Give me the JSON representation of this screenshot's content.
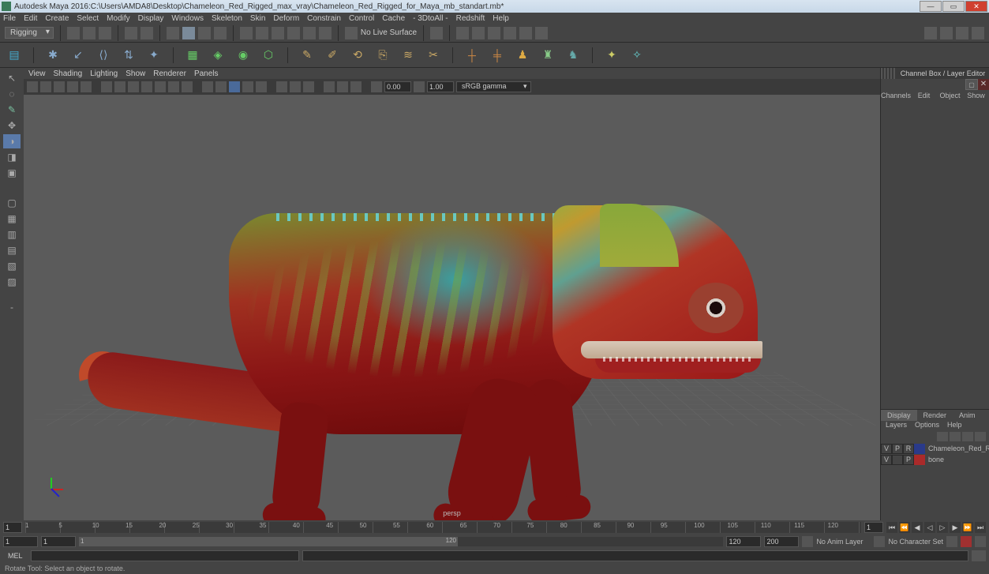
{
  "titlebar": {
    "app": "Autodesk Maya 2016: ",
    "path": "C:\\Users\\AMDA8\\Desktop\\Chameleon_Red_Rigged_max_vray\\Chameleon_Red_Rigged_for_Maya_mb_standart.mb*"
  },
  "menubar": [
    "File",
    "Edit",
    "Create",
    "Select",
    "Modify",
    "Display",
    "Windows",
    "Skeleton",
    "Skin",
    "Deform",
    "Constrain",
    "Control",
    "Cache",
    "- 3DtoAll -",
    "Redshift",
    "Help"
  ],
  "shelf": {
    "workspace": "Rigging",
    "live_surface": "No Live Surface"
  },
  "panel_menubar": [
    "View",
    "Shading",
    "Lighting",
    "Show",
    "Renderer",
    "Panels"
  ],
  "panel_toolbar": {
    "exposure": "0.00",
    "gamma": "1.00",
    "color_space": "sRGB gamma"
  },
  "viewport": {
    "camera": "persp"
  },
  "right_panel": {
    "title": "Channel Box / Layer Editor",
    "tabs": [
      "Channels",
      "Edit",
      "Object",
      "Show"
    ],
    "layer_tabs": [
      "Display",
      "Render",
      "Anim"
    ],
    "layer_opts": [
      "Layers",
      "Options",
      "Help"
    ],
    "layers": [
      {
        "v": "V",
        "p": "P",
        "r": "R",
        "swatch": "#2a3a8a",
        "name": "Chameleon_Red_Rigg"
      },
      {
        "v": "V",
        "p": "",
        "r": "P",
        "swatch": "#aa2a2a",
        "name": "bone"
      }
    ]
  },
  "time_slider": {
    "start": "1",
    "current": "1",
    "ticks": [
      "1",
      "5",
      "10",
      "15",
      "20",
      "25",
      "30",
      "35",
      "40",
      "45",
      "50",
      "55",
      "60",
      "65",
      "70",
      "75",
      "80",
      "85",
      "90",
      "95",
      "100",
      "105",
      "110",
      "115",
      "120"
    ]
  },
  "range_slider": {
    "anim_start": "1",
    "range_start": "1",
    "range_label_start": "1",
    "range_label_end": "120",
    "range_end": "120",
    "anim_end": "200",
    "anim_layer": "No Anim Layer",
    "char_set": "No Character Set"
  },
  "cmdline": {
    "lang": "MEL"
  },
  "helpline": "Rotate Tool: Select an object to rotate."
}
